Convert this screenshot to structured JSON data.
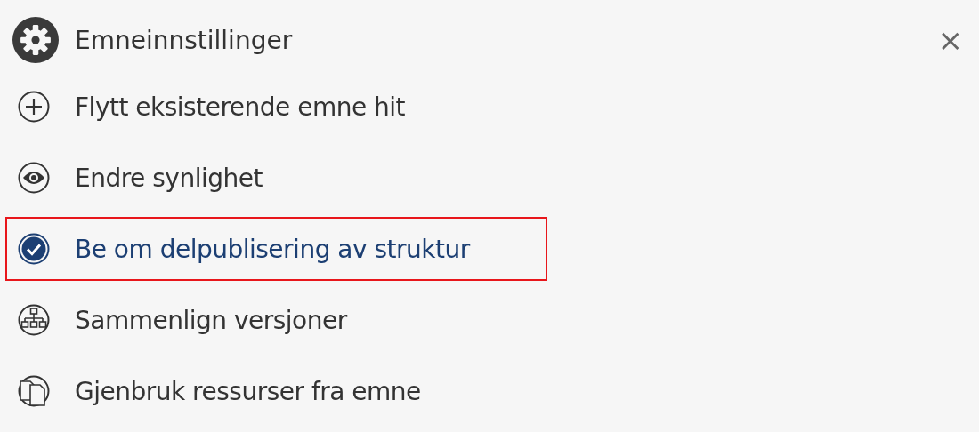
{
  "header": {
    "title": "Emneinnstillinger",
    "close": "×"
  },
  "items": [
    {
      "label": "Flytt eksisterende emne hit",
      "kind": "plus",
      "selected": false
    },
    {
      "label": "Endre synlighet",
      "kind": "eye",
      "selected": false
    },
    {
      "label": "Be om delpublisering av struktur",
      "kind": "check",
      "selected": true
    },
    {
      "label": "Sammenlign versjoner",
      "kind": "tree",
      "selected": false
    },
    {
      "label": "Gjenbruk ressurser fra emne",
      "kind": "pages",
      "selected": false
    }
  ]
}
